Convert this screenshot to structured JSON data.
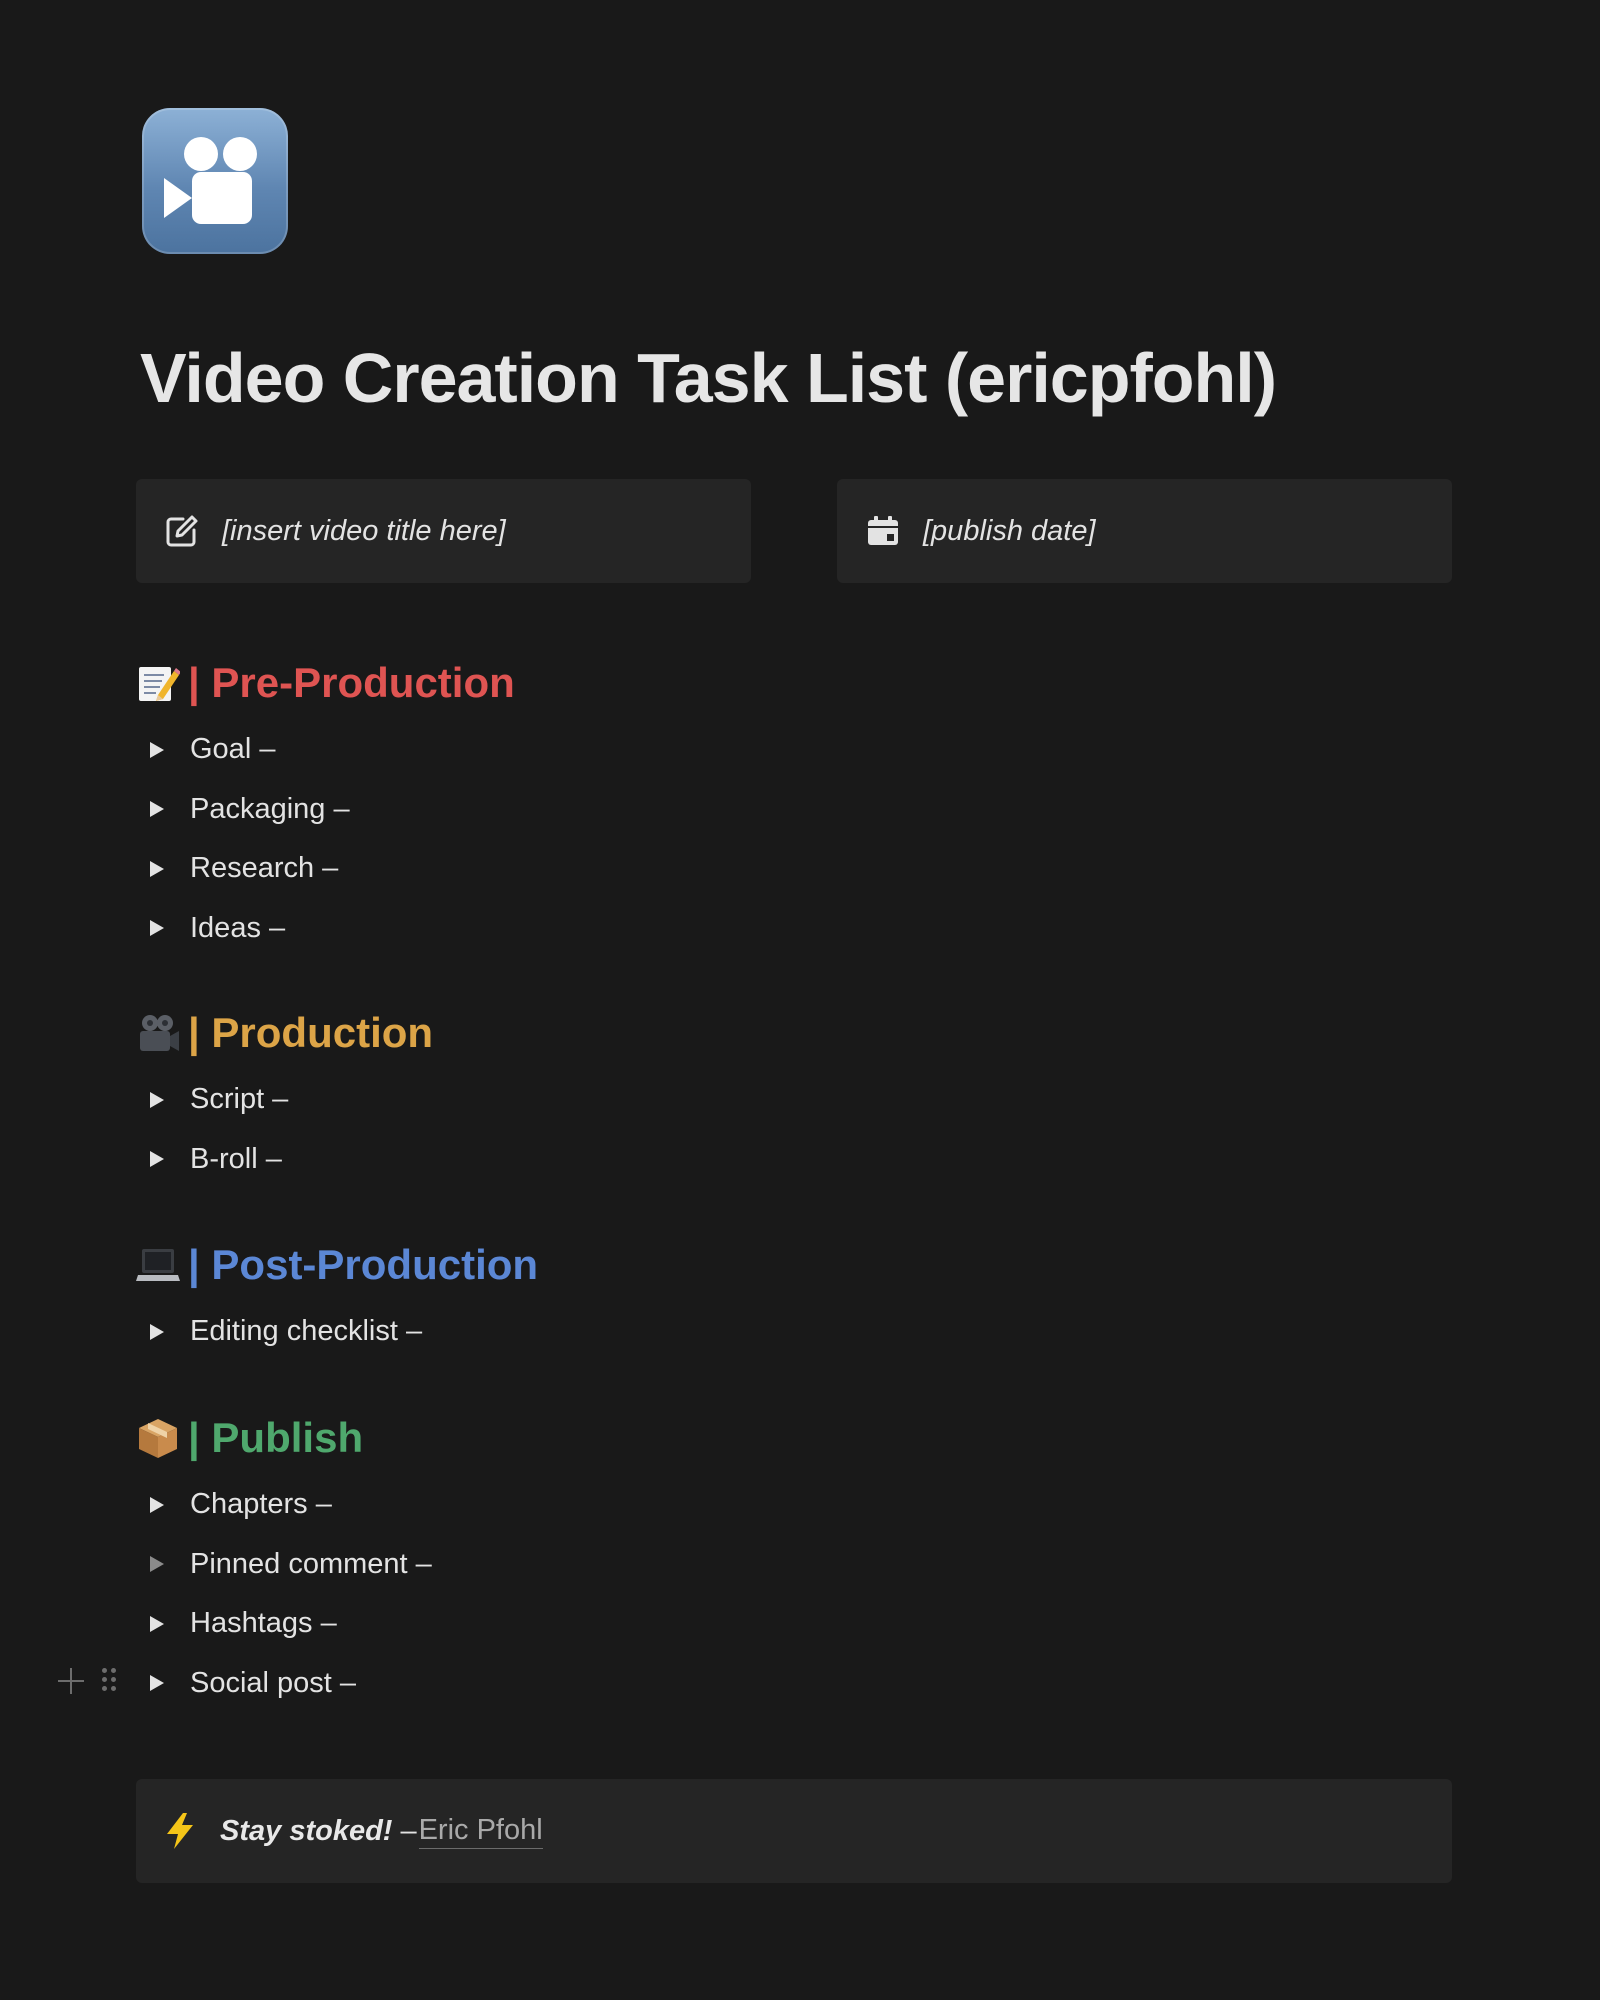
{
  "page": {
    "icon": "movie-camera-icon",
    "title": "Video Creation Task List (ericpfohl)"
  },
  "callouts": {
    "video_title": {
      "icon": "edit-icon",
      "text": "[insert video title here]"
    },
    "publish_date": {
      "icon": "calendar-icon",
      "text": "[publish date]"
    }
  },
  "sections": [
    {
      "id": "pre-production",
      "emoji": "memo-icon",
      "heading": "| Pre-Production",
      "color": "#df5452",
      "items": [
        "Goal –",
        "Packaging –",
        "Research –",
        "Ideas –"
      ]
    },
    {
      "id": "production",
      "emoji": "movie-camera-icon",
      "heading": "| Production",
      "color": "#dca447",
      "items": [
        "Script –",
        "B-roll –"
      ]
    },
    {
      "id": "post-production",
      "emoji": "laptop-icon",
      "heading": "| Post-Production",
      "color": "#5b87d5",
      "items": [
        "Editing checklist –"
      ]
    },
    {
      "id": "publish",
      "emoji": "package-icon",
      "heading": "| Publish",
      "color": "#4fa86d",
      "items": [
        "Chapters –",
        "Pinned comment –",
        "Hashtags –",
        "Social post –"
      ]
    }
  ],
  "quote": {
    "icon": "lightning-icon",
    "strong": "Stay stoked!",
    "dash": "–",
    "author": "Eric Pfohl"
  }
}
